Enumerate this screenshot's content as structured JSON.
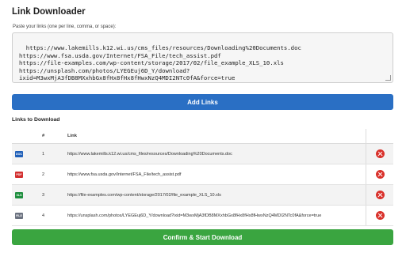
{
  "app": {
    "title": "Link Downloader",
    "hint": "Paste your links (one per line, comma, or space):"
  },
  "input": {
    "value": "https://www.lakemills.k12.wi.us/cms_files/resources/Downloading%20Documents.doc\nhttps://www.fsa.usda.gov/Internet/FSA_File/tech_assist.pdf\nhttps://file-examples.com/wp-content/storage/2017/02/file_example_XLS_10.xls\nhttps://unsplash.com/photos/LYEGEuj6D_Y/download?\nixid=M3wxMjA3fDB8MXxhbGx8fHx8fHx8fHwxNzQ4MDI2NTc0fA&force=true"
  },
  "buttons": {
    "add": "Add Links",
    "confirm": "Confirm & Start Download"
  },
  "links_section": {
    "title": "Links to Download",
    "columns": [
      "",
      "#",
      "Link",
      ""
    ],
    "rows": [
      {
        "num": "1",
        "type": "DOC",
        "color": "#1f5fb8",
        "icon": "doc-file-icon",
        "link": "https://www.lakemills.k12.wi.us/cms_files/resources/Downloading%20Documents.doc"
      },
      {
        "num": "2",
        "type": "PDF",
        "color": "#d32f2f",
        "icon": "pdf-file-icon",
        "link": "https://www.fsa.usda.gov/Internet/FSA_File/tech_assist.pdf"
      },
      {
        "num": "3",
        "type": "XLS",
        "color": "#1e8e3e",
        "icon": "xls-file-icon",
        "link": "https://file-examples.com/wp-content/storage/2017/02/file_example_XLS_10.xls"
      },
      {
        "num": "4",
        "type": "FILE",
        "color": "#6b7280",
        "icon": "generic-file-icon",
        "link": "https://unsplash.com/photos/LYEGEuj6D_Y/download?ixid=M3wxMjA3fDB8MXxhbGx8fHx8fHx8fHwxNzQ4MDI2NTc0fA&force=true"
      }
    ]
  },
  "colors": {
    "primary": "#2a6fc4",
    "success": "#3aa540",
    "danger": "#d9312b"
  }
}
